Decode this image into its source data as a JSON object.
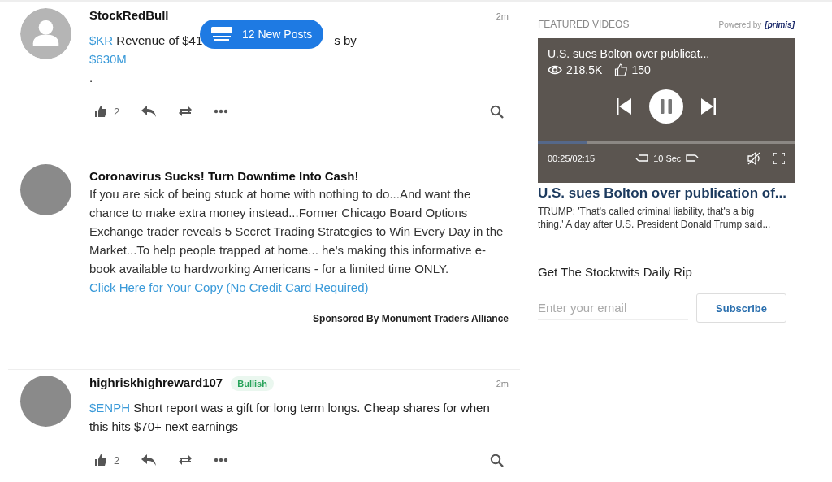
{
  "new_posts_pill": {
    "label": "12 New Posts"
  },
  "feed": [
    {
      "kind": "message",
      "username": "StockRedBull",
      "avatar": {
        "kind": "silhouette"
      },
      "time": "2m",
      "lines": [
        [
          {
            "kind": "ticker",
            "text": "$KR"
          },
          {
            "kind": "text",
            "text": " Revenue of $41"
          },
          {
            "kind": "covered"
          },
          {
            "kind": "text",
            "text": "s by"
          }
        ],
        [
          {
            "kind": "ticker",
            "text": "$630M"
          }
        ],
        [
          {
            "kind": "text",
            "text": "."
          }
        ]
      ],
      "likes": "2"
    },
    {
      "kind": "ad",
      "avatar": {
        "kind": "photo"
      },
      "title": "Coronavirus Sucks! Turn Downtime Into Cash!",
      "body": "If you are sick of being stuck at home with nothing to do...And want the chance to make extra money instead...Former Chicago Board Options Exchange trader reveals 5 Secret Trading Strategies to Win Every Day in the Market...To help people trapped at home... he's making this informative e-book available to hardworking Americans - for a limited time ONLY.",
      "link": "Click Here for Your Copy (No Credit Card Required)",
      "sponsor": "Sponsored By Monument Traders Alliance"
    },
    {
      "kind": "message",
      "username": "highriskhighreward107",
      "avatar": {
        "kind": "photo"
      },
      "sentiment": "Bullish",
      "time": "2m",
      "lines": [
        [
          {
            "kind": "ticker",
            "text": "$ENPH"
          },
          {
            "kind": "text",
            "text": " Short report was a gift for long term longs. Cheap shares for when this hits $70+ next earnings"
          }
        ]
      ],
      "likes": "2"
    }
  ],
  "sidebar": {
    "featured_heading": "FEATURED VIDEOS",
    "powered_by": "Powered by",
    "provider_logo": "[primis]",
    "video": {
      "title": "U.S. sues Bolton over publicat...",
      "views": "218.5K",
      "likes": "150",
      "playing": true,
      "level": 0.19,
      "time": "00:25/02:15",
      "skip": "10 Sec",
      "muted": true
    },
    "headline": "U.S. sues Bolton over publication of...",
    "summary": "TRUMP: 'That's called criminal liability, that's a big thing.' A day after U.S. President Donald Trump said...",
    "newsletter": {
      "heading": "Get The Stocktwits Daily Rip",
      "placeholder": "Enter your email",
      "button": "Subscribe"
    }
  }
}
